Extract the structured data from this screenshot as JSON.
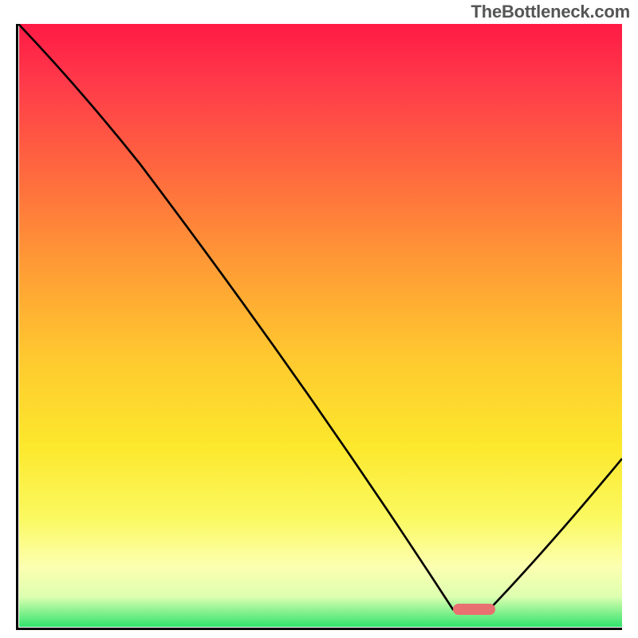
{
  "watermark": "TheBottleneck.com",
  "chart_data": {
    "type": "line",
    "title": "",
    "xlabel": "",
    "ylabel": "",
    "xlim": [
      0,
      100
    ],
    "ylim": [
      0,
      100
    ],
    "x": [
      0,
      20,
      72,
      78,
      100
    ],
    "values": [
      100,
      77,
      3,
      3,
      28
    ],
    "marker": {
      "x_start": 72,
      "x_end": 79,
      "y": 3
    },
    "background_gradient": {
      "orientation": "vertical",
      "stops": [
        {
          "pct": 0,
          "color": "#ff1a45"
        },
        {
          "pct": 25,
          "color": "#ff6a3e"
        },
        {
          "pct": 55,
          "color": "#ffc82f"
        },
        {
          "pct": 82,
          "color": "#fbf961"
        },
        {
          "pct": 100,
          "color": "#31e36d"
        }
      ]
    }
  }
}
